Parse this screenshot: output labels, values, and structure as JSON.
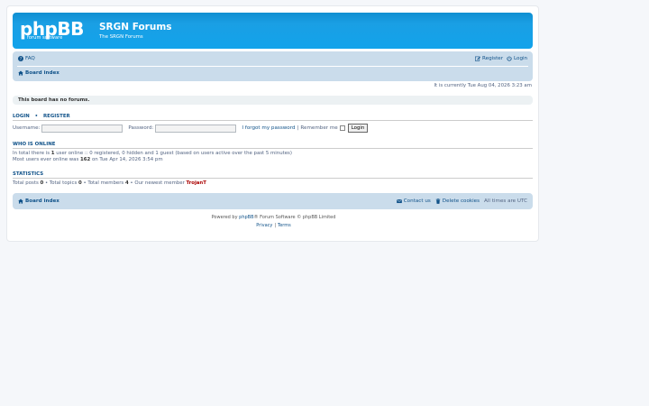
{
  "header": {
    "logo_text": "phpBB",
    "logo_sub": "forum software",
    "site_title": "SRGN Forums",
    "site_description": "The SRGN Forums"
  },
  "navbar": {
    "faq": "FAQ",
    "register": "Register",
    "login": "Login",
    "board_index": "Board index"
  },
  "current_time": "It is currently Tue Aug 04, 2026 3:23 am",
  "no_forums": "This board has no forums.",
  "login_section": {
    "login": "LOGIN",
    "bullet": "•",
    "register": "REGISTER",
    "username_label": "Username:",
    "password_label": "Password:",
    "forgot": "I forgot my password",
    "divider": "|",
    "remember": "Remember me",
    "button": "Login"
  },
  "who_is_online": {
    "heading": "WHO IS ONLINE",
    "line1_a": "In total there is ",
    "line1_count": "1",
    "line1_b": " user online :: 0 registered, 0 hidden and 1 guest (based on users active over the past 5 minutes)",
    "line2_a": "Most users ever online was ",
    "line2_count": "162",
    "line2_b": " on Tue Apr 14, 2026 3:54 pm"
  },
  "statistics": {
    "heading": "STATISTICS",
    "posts_label": "Total posts ",
    "posts": "0",
    "topics_label": " • Total topics ",
    "topics": "0",
    "members_label": " • Total members ",
    "members": "4",
    "newest_label": " • Our newest member ",
    "newest": "TrojanT"
  },
  "footer": {
    "board_index": "Board index",
    "contact": "Contact us",
    "delete_cookies": "Delete cookies",
    "timezone": "All times are UTC",
    "powered_a": "Powered by ",
    "powered_link": "phpBB",
    "powered_b": "® Forum Software © phpBB Limited",
    "privacy": "Privacy",
    "divider": "|",
    "terms": "Terms"
  },
  "colors": {
    "header_blue": "#12a3eb",
    "nav_bg": "#cadceb",
    "link": "#105289",
    "newest_member": "#aa0000"
  }
}
